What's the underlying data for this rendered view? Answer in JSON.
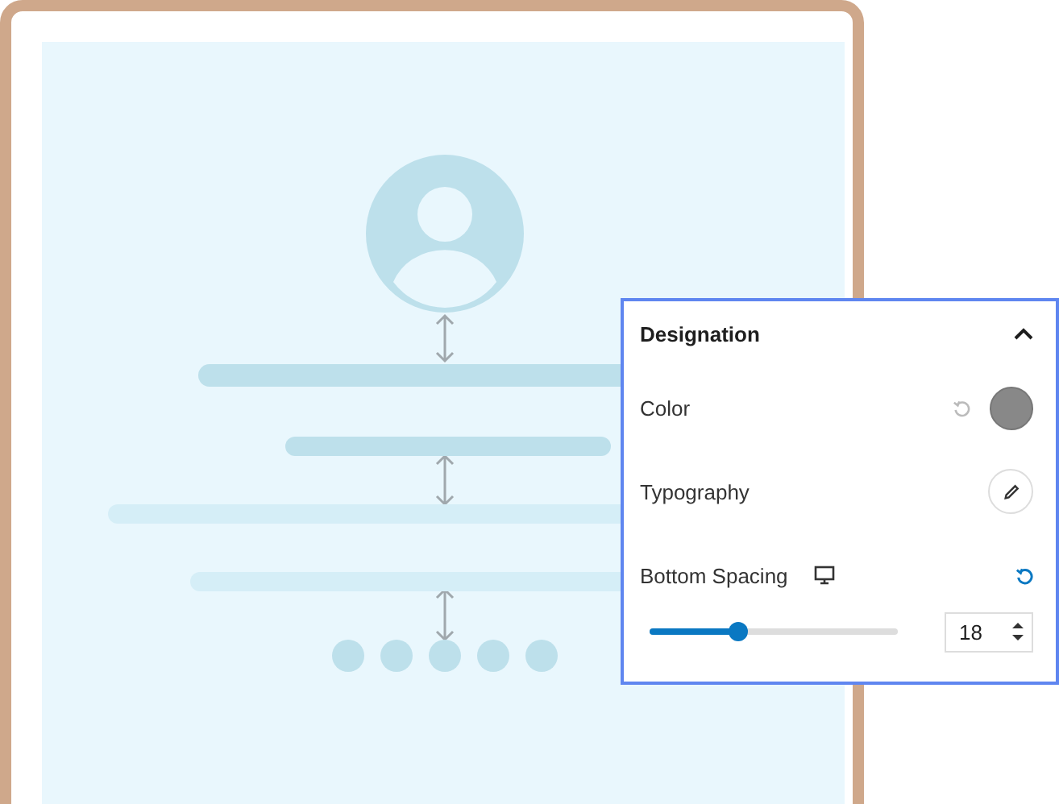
{
  "panel": {
    "title": "Designation",
    "expanded": true,
    "rows": [
      {
        "kind": "color",
        "label": "Color",
        "color": "#888888"
      },
      {
        "kind": "typography",
        "label": "Typography"
      },
      {
        "kind": "spacing",
        "label": "Bottom Spacing",
        "level": 0.36,
        "value": "18"
      }
    ]
  }
}
